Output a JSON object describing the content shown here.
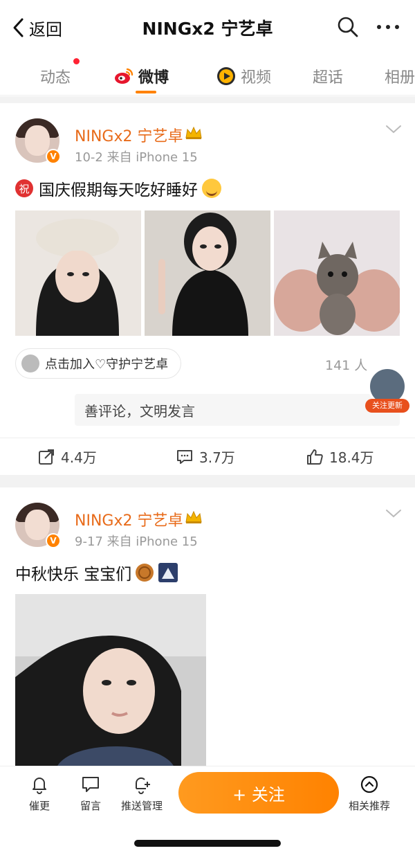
{
  "header": {
    "back_label": "返回",
    "title": "NINGx2 宁艺卓"
  },
  "tabs": [
    {
      "label": "动态"
    },
    {
      "label": "微博"
    },
    {
      "label": "视频"
    },
    {
      "label": "超话"
    },
    {
      "label": "相册"
    }
  ],
  "posts": [
    {
      "username": "NINGx2 宁艺卓",
      "meta": "10-2  来自 iPhone 15",
      "badge": "祝",
      "text": "国庆假期每天吃好睡好",
      "fan_pill": "点击加入♡守护宁艺卓",
      "fan_count": "141 人",
      "comment_placeholder": "善评论，文明发言",
      "actions": {
        "repost": "4.4万",
        "comment": "3.7万",
        "like": "18.4万"
      }
    },
    {
      "username": "NINGx2 宁艺卓",
      "meta": "9-17  来自 iPhone 15",
      "text": "中秋快乐 宝宝们"
    }
  ],
  "floating_follow": {
    "label": "关注更新"
  },
  "bottom_bar": {
    "urge": "催更",
    "message": "留言",
    "push": "推送管理",
    "follow": "+ 关注",
    "related": "相关推荐"
  },
  "colors": {
    "accent": "#ff8200",
    "username": "#e86b1a"
  }
}
